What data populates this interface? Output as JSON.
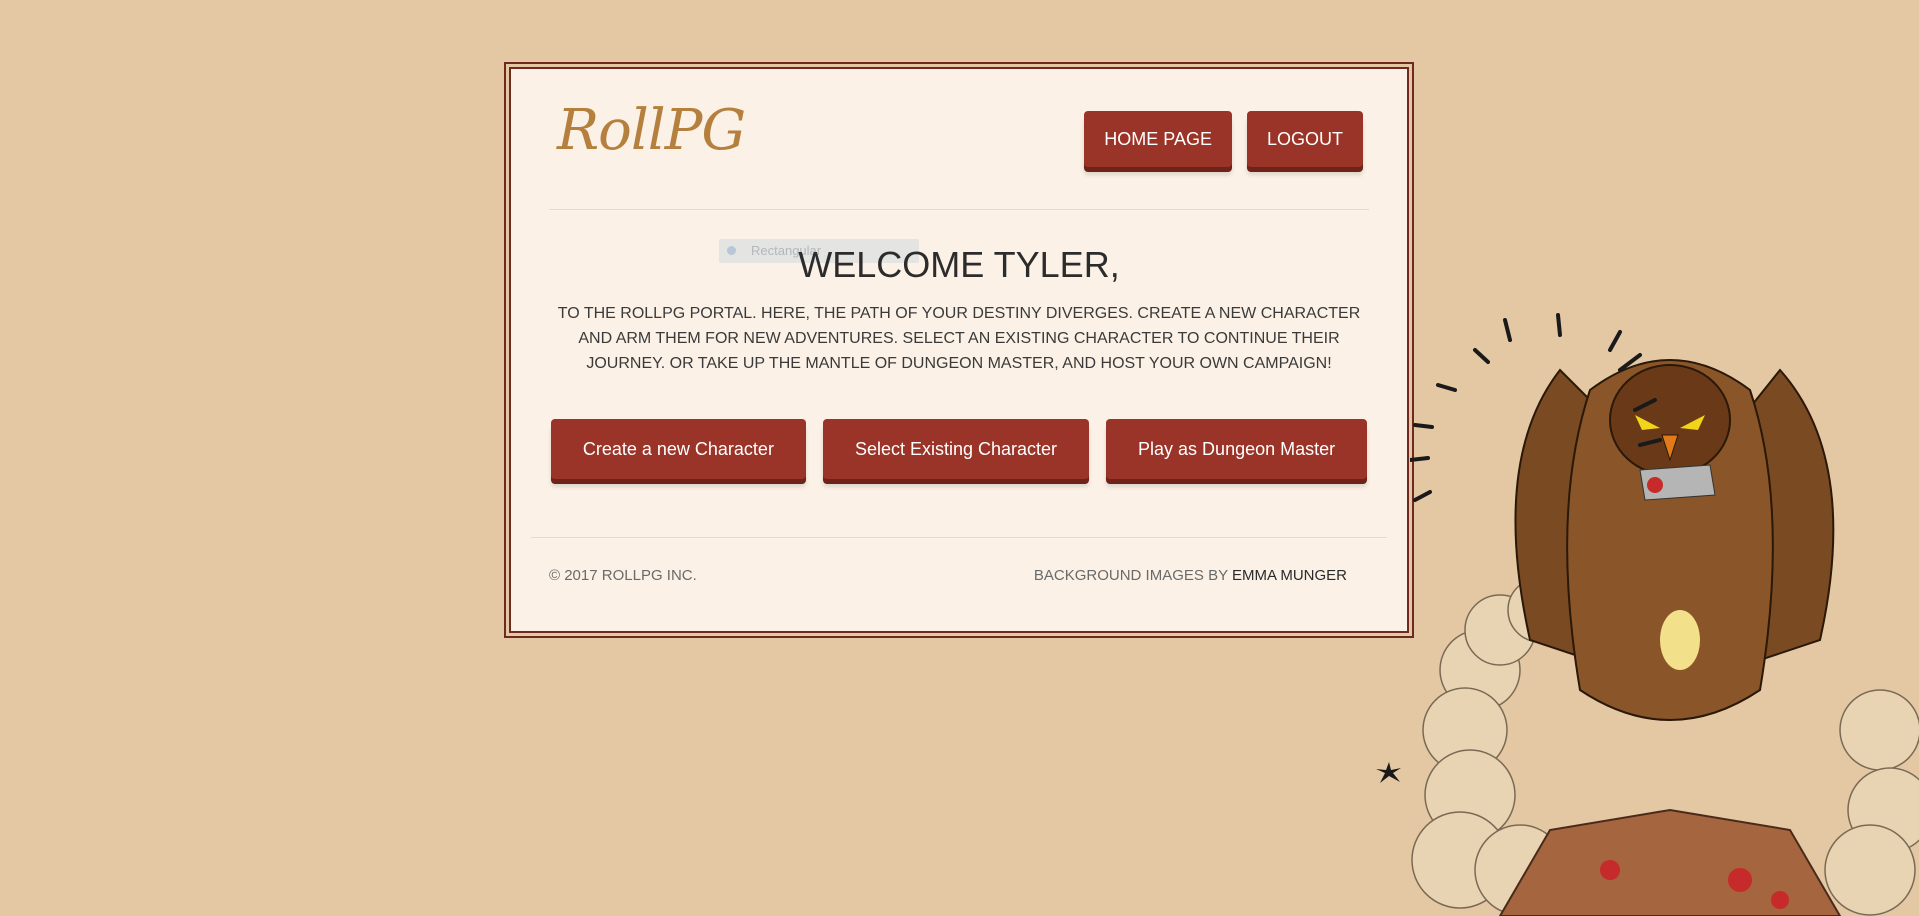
{
  "brand": {
    "logo_text": "RollPG"
  },
  "nav": {
    "home_label": "HOME PAGE",
    "logout_label": "LOGOUT"
  },
  "ghost_tooltip": {
    "text": "Rectangular"
  },
  "welcome": {
    "title": "WELCOME TYLER,",
    "intro": "TO THE ROLLPG PORTAL. HERE, THE PATH OF YOUR DESTINY DIVERGES. CREATE A NEW CHARACTER AND ARM THEM FOR NEW ADVENTURES. SELECT AN EXISTING CHARACTER TO CONTINUE THEIR JOURNEY. OR TAKE UP THE MANTLE OF DUNGEON MASTER, AND HOST YOUR OWN CAMPAIGN!"
  },
  "actions": {
    "create_label": "Create a new Character",
    "select_label": "Select Existing Character",
    "dm_label": "Play as Dungeon Master"
  },
  "footer": {
    "copyright": "© 2017 ROLLPG INC.",
    "credit_prefix": "BACKGROUND IMAGES BY ",
    "credit_name": "EMMA MUNGER"
  },
  "colors": {
    "background": "#e3c8a3",
    "card": "#fbf1e6",
    "button": "#9b3428",
    "button_shadow": "#6e2319",
    "border": "#6e2a20",
    "logo": "#b5803e"
  },
  "icons": {
    "illustration": "owl-monster-illustration"
  }
}
